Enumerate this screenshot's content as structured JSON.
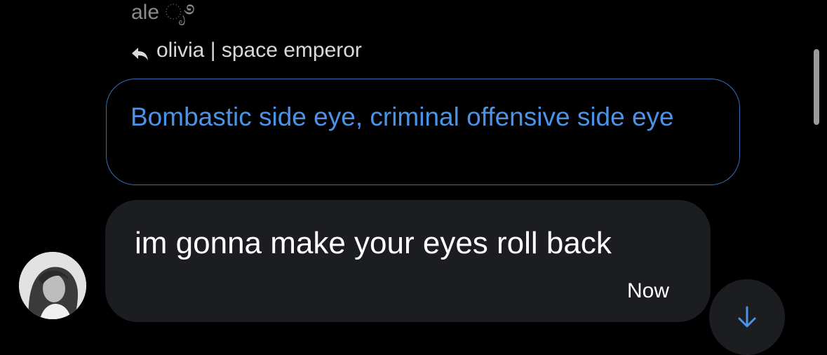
{
  "message_group": {
    "sender_name": "ale ೃ࿔",
    "reply": {
      "icon": "reply-arrow-icon",
      "label": "olivia | space emperor"
    },
    "quoted_message": {
      "text": "Bombastic side eye, criminal offensive side eye"
    },
    "message": {
      "text": "im gonna make your eyes roll back",
      "timestamp": "Now"
    },
    "avatar": {
      "icon": "user-avatar"
    }
  },
  "scroll_to_bottom": {
    "icon": "arrow-down-icon"
  },
  "colors": {
    "background": "#000000",
    "bubble": "#1c1d20",
    "quote_border": "#3a6fb8",
    "quote_text": "#4a93e6",
    "accent_arrow": "#4a93e6",
    "muted_text": "#8b8b8b"
  }
}
